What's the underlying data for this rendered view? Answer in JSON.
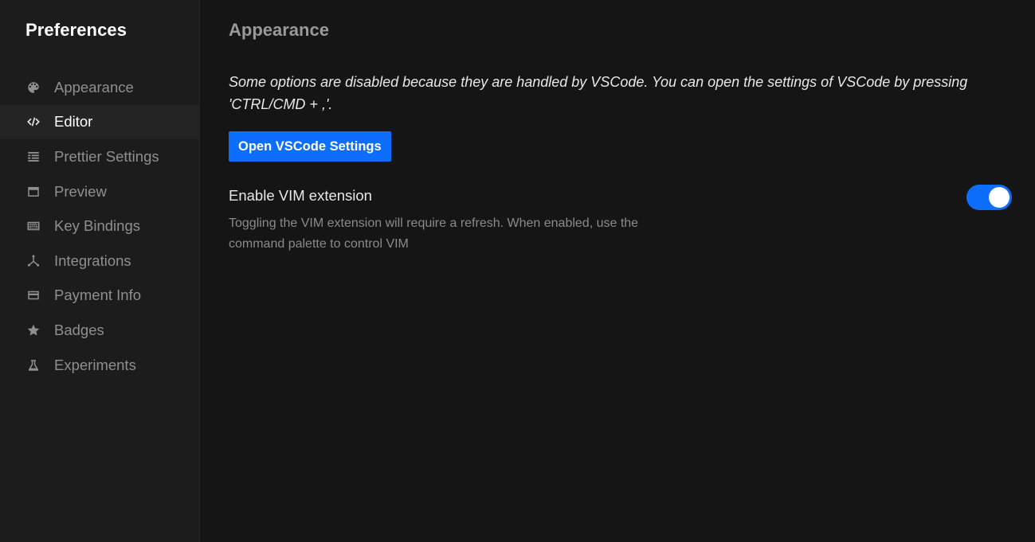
{
  "sidebar": {
    "title": "Preferences",
    "items": [
      {
        "label": "Appearance",
        "icon": "palette-icon"
      },
      {
        "label": "Editor",
        "icon": "code-icon",
        "active": true
      },
      {
        "label": "Prettier Settings",
        "icon": "format-list-icon"
      },
      {
        "label": "Preview",
        "icon": "window-icon"
      },
      {
        "label": "Key Bindings",
        "icon": "keyboard-icon"
      },
      {
        "label": "Integrations",
        "icon": "integrations-icon"
      },
      {
        "label": "Payment Info",
        "icon": "credit-card-icon"
      },
      {
        "label": "Badges",
        "icon": "star-icon"
      },
      {
        "label": "Experiments",
        "icon": "flask-icon"
      }
    ]
  },
  "main": {
    "title": "Appearance",
    "notice": "Some options are disabled because they are handled by VSCode. You can open the settings of VSCode by pressing 'CTRL/CMD + ,'.",
    "open_button": "Open VSCode Settings",
    "setting": {
      "label": "Enable VIM extension",
      "description": "Toggling the VIM extension will require a refresh. When enabled, use the command palette to control VIM",
      "enabled": true
    }
  },
  "colors": {
    "accent": "#0d6efd",
    "background": "#151515",
    "sidebar": "#1c1c1c",
    "active_item": "#242424"
  }
}
